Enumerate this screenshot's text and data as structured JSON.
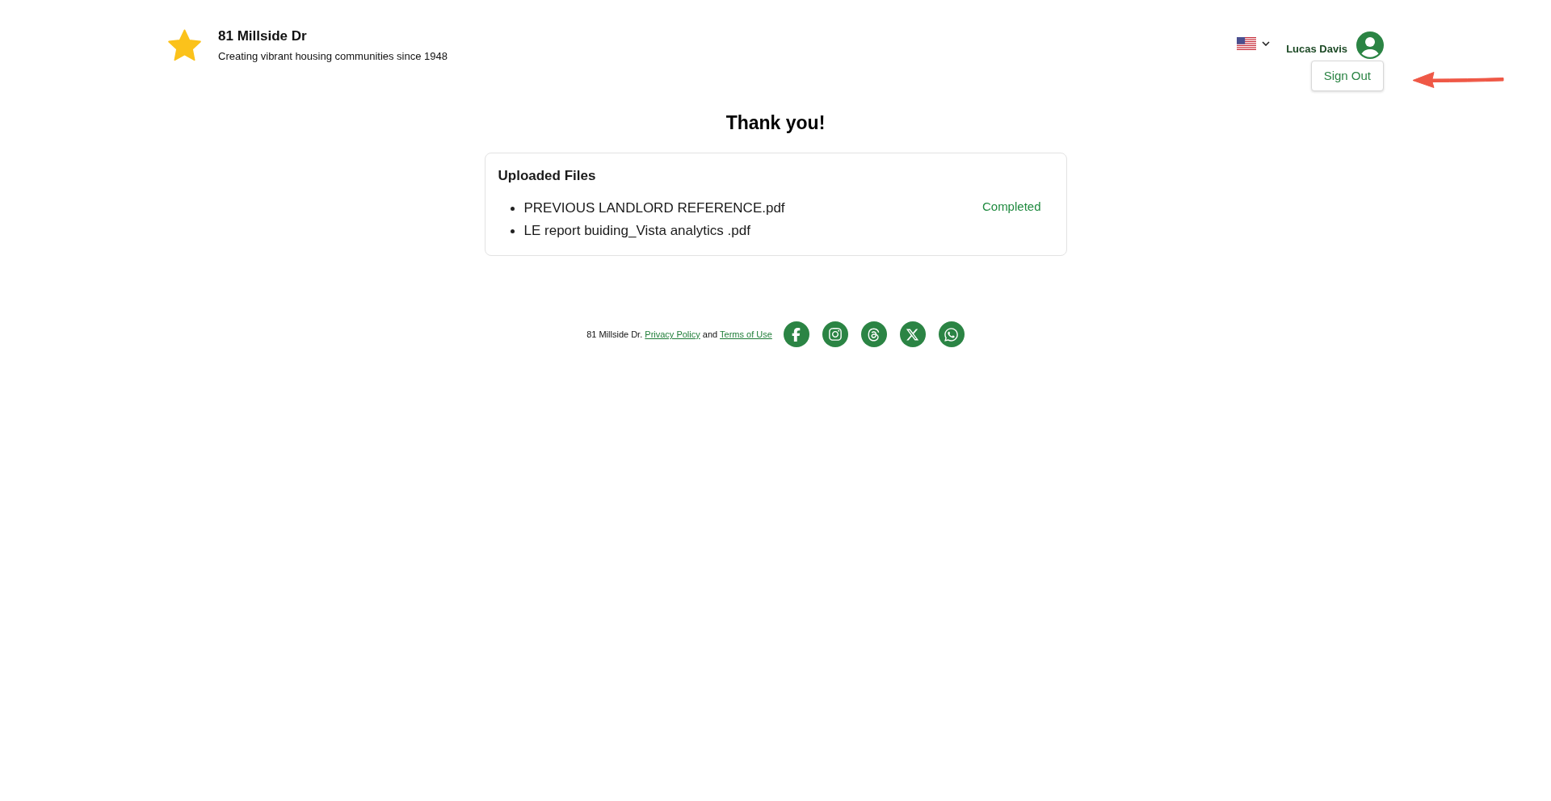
{
  "header": {
    "title": "81 Millside Dr",
    "tagline": "Creating vibrant housing communities since 1948",
    "user": {
      "name": "Lucas Davis",
      "menu": [
        {
          "label": "Sign Out"
        }
      ]
    }
  },
  "heading": "Thank you!",
  "uploads": {
    "title": "Uploaded Files",
    "files": [
      {
        "name": "PREVIOUS LANDLORD REFERENCE.pdf"
      },
      {
        "name": "LE report buiding_Vista analytics .pdf"
      }
    ],
    "status": "Completed"
  },
  "footer": {
    "prefix": "81 Millside Dr.",
    "privacy_link": "Privacy Policy",
    "conjunction": "and",
    "terms_link": "Terms of Use"
  }
}
